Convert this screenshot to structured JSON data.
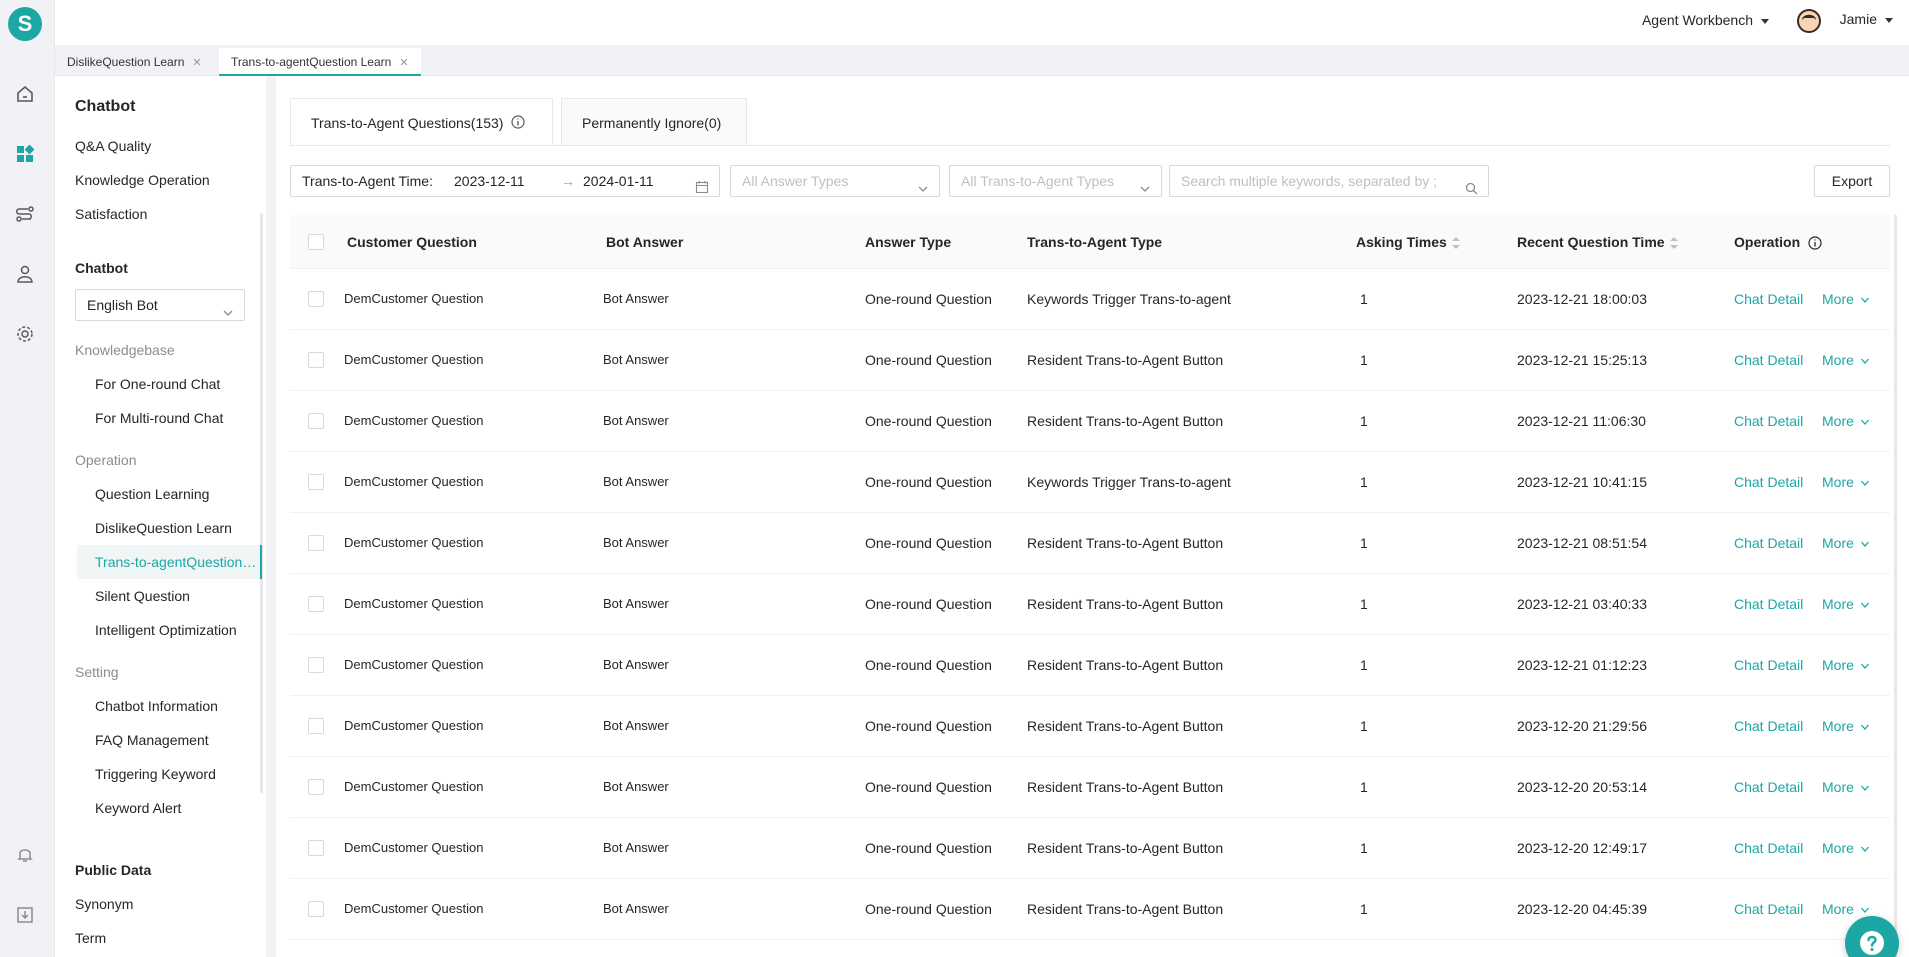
{
  "app": {
    "logo_letter": "S"
  },
  "topbar": {
    "workbench": "Agent Workbench",
    "user": "Jamie"
  },
  "page_tabs": [
    {
      "label": "DislikeQuestion Learn",
      "active": false
    },
    {
      "label": "Trans-to-agentQuestion Learn",
      "active": true
    }
  ],
  "sidebar": {
    "title": "Chatbot",
    "top_items": [
      "Q&A Quality",
      "Knowledge Operation",
      "Satisfaction"
    ],
    "chatbot_heading": "Chatbot",
    "bot_select": "English Bot",
    "knowledgebase": {
      "label": "Knowledgebase",
      "items": [
        "For One-round Chat",
        "For Multi-round Chat"
      ]
    },
    "operation": {
      "label": "Operation",
      "items": [
        "Question Learning",
        "DislikeQuestion Learn",
        "Trans-to-agentQuestion Learn",
        "Silent Question",
        "Intelligent Optimization"
      ],
      "active_index": 2
    },
    "setting": {
      "label": "Setting",
      "items": [
        "Chatbot Information",
        "FAQ Management",
        "Triggering Keyword",
        "Keyword Alert"
      ]
    },
    "public_data": {
      "heading": "Public Data",
      "items": [
        "Synonym",
        "Term"
      ]
    }
  },
  "content_tabs": [
    {
      "label": "Trans-to-Agent Questions(153)",
      "active": true
    },
    {
      "label": "Permanently Ignore(0)",
      "active": false
    }
  ],
  "filters": {
    "date_label": "Trans-to-Agent Time",
    "date_start": "2023-12-11",
    "date_end": "2024-01-11",
    "answer_types_placeholder": "All Answer Types",
    "trans_types_placeholder": "All Trans-to-Agent Types",
    "search_placeholder": "Search multiple keywords, separated by ;",
    "export_label": "Export"
  },
  "table": {
    "columns": [
      "Customer Question",
      "Bot Answer",
      "Answer Type",
      "Trans-to-Agent Type",
      "Asking Times",
      "Recent Question Time",
      "Operation"
    ],
    "rows": [
      {
        "question": "DemCustomer Question",
        "answer": "Bot Answer",
        "answer_type": "One-round Question",
        "trans_type": "Keywords Trigger Trans-to-agent",
        "times": "1",
        "time": "2023-12-21 18:00:03"
      },
      {
        "question": "DemCustomer Question",
        "answer": "Bot Answer",
        "answer_type": "One-round Question",
        "trans_type": "Resident Trans-to-Agent Button",
        "times": "1",
        "time": "2023-12-21 15:25:13"
      },
      {
        "question": "DemCustomer Question",
        "answer": "Bot Answer",
        "answer_type": "One-round Question",
        "trans_type": "Resident Trans-to-Agent Button",
        "times": "1",
        "time": "2023-12-21 11:06:30"
      },
      {
        "question": "DemCustomer Question",
        "answer": "Bot Answer",
        "answer_type": "One-round Question",
        "trans_type": "Keywords Trigger Trans-to-agent",
        "times": "1",
        "time": "2023-12-21 10:41:15"
      },
      {
        "question": "DemCustomer Question",
        "answer": "Bot Answer",
        "answer_type": "One-round Question",
        "trans_type": "Resident Trans-to-Agent Button",
        "times": "1",
        "time": "2023-12-21 08:51:54"
      },
      {
        "question": "DemCustomer Question",
        "answer": "Bot Answer",
        "answer_type": "One-round Question",
        "trans_type": "Resident Trans-to-Agent Button",
        "times": "1",
        "time": "2023-12-21 03:40:33"
      },
      {
        "question": "DemCustomer Question",
        "answer": "Bot Answer",
        "answer_type": "One-round Question",
        "trans_type": "Resident Trans-to-Agent Button",
        "times": "1",
        "time": "2023-12-21 01:12:23"
      },
      {
        "question": "DemCustomer Question",
        "answer": "Bot Answer",
        "answer_type": "One-round Question",
        "trans_type": "Resident Trans-to-Agent Button",
        "times": "1",
        "time": "2023-12-20 21:29:56"
      },
      {
        "question": "DemCustomer Question",
        "answer": "Bot Answer",
        "answer_type": "One-round Question",
        "trans_type": "Resident Trans-to-Agent Button",
        "times": "1",
        "time": "2023-12-20 20:53:14"
      },
      {
        "question": "DemCustomer Question",
        "answer": "Bot Answer",
        "answer_type": "One-round Question",
        "trans_type": "Resident Trans-to-Agent Button",
        "times": "1",
        "time": "2023-12-20 12:49:17"
      },
      {
        "question": "DemCustomer Question",
        "answer": "Bot Answer",
        "answer_type": "One-round Question",
        "trans_type": "Resident Trans-to-Agent Button",
        "times": "1",
        "time": "2023-12-20 04:45:39"
      }
    ],
    "op_detail": "Chat Detail",
    "op_more": "More"
  },
  "colors": {
    "accent": "#1ca7a5"
  }
}
